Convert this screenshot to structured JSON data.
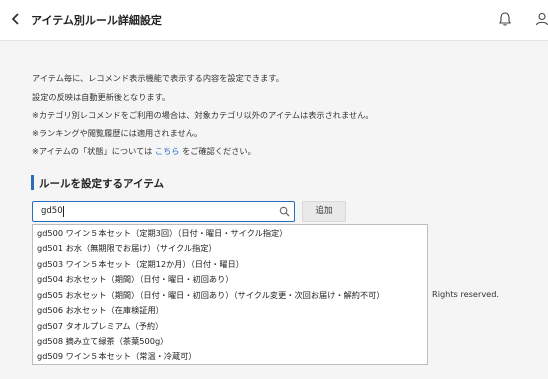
{
  "header": {
    "title": "アイテム別ルール詳細設定"
  },
  "description": {
    "line1": "アイテム毎に、レコメンド表示機能で表示する内容を設定できます。",
    "line2": "設定の反映は自動更新後となります。",
    "line3": "※カテゴリ別レコメンドをご利用の場合は、対象カテゴリ以外のアイテムは表示されません。",
    "line4": "※ランキングや閲覧履歴には適用されません。",
    "line5_prefix": "※アイテムの「状態」については",
    "line5_link": "こちら",
    "line5_suffix": "をご確認ください。"
  },
  "section": {
    "title": "ルールを設定するアイテム"
  },
  "search": {
    "value": "gd50"
  },
  "add_button": "追加",
  "dropdown": {
    "options": [
      "gd500 ワイン５本セット（定期3回）（日付・曜日・サイクル指定）",
      "gd501 お水（無期限でお届け）（サイクル指定）",
      "gd503 ワイン５本セット（定期12か月）（日付・曜日）",
      "gd504 お水セット（期間）（日付・曜日・初回あり）",
      "gd505 お水セット（期間）（日付・曜日・初回あり）（サイクル変更・次回お届け・解約不可）",
      "gd506 お水セット（在庫検証用）",
      "gd507 タオルプレミアム（予約）",
      "gd508 摘み立て緑茶（茶葉500g）",
      "gd509 ワイン５本セット（常温・冷蔵可）"
    ]
  },
  "footer": {
    "rights": "Rights reserved."
  }
}
